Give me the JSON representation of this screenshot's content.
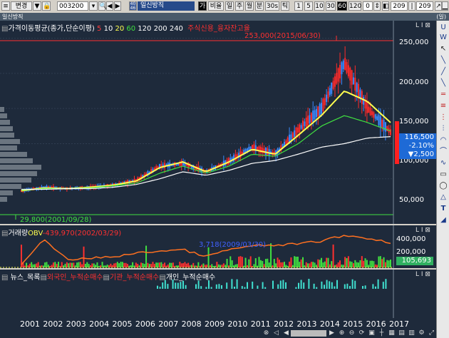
{
  "toolbar": {
    "code": "003200",
    "badge": "40\n46",
    "stock_name": "일신방직",
    "buttons": [
      "가",
      "비율",
      "일",
      "주",
      "월",
      "분",
      "30s",
      "틱"
    ],
    "periods": [
      "1",
      "5",
      "10",
      "30",
      "60",
      "120"
    ],
    "period_count": "0",
    "count_a": "209",
    "count_b": "209"
  },
  "titlebar": {
    "title": "일신방직",
    "right": "(일)"
  },
  "price_panel": {
    "header": "가격이동평균(종가,단순이평)",
    "ma_labels": [
      {
        "text": "5",
        "color": "#ff3c3c"
      },
      {
        "text": "10",
        "color": "#ffffff"
      },
      {
        "text": "20",
        "color": "#ffff50"
      },
      {
        "text": "60",
        "color": "#40e040"
      },
      {
        "text": "120",
        "color": "#ffffff"
      },
      {
        "text": "200",
        "color": "#ffffff"
      },
      {
        "text": "240",
        "color": "#ffffff"
      }
    ],
    "credit_label": "주식신용_융자잔고율",
    "high_label": "253,000(2015/06/30)",
    "low_label": "29,800(2001/09/28)",
    "y_ticks": [
      "250,000",
      "200,000",
      "150,000",
      "100,000",
      "50,000"
    ],
    "current_price": "116,500",
    "change_pct": "-2.10%",
    "change_amt": "▼2,500"
  },
  "volume_panel": {
    "header": "거래량",
    "obv_label": "OBV",
    "obv_value": "-439,970(2002/03/29)",
    "mark_label": "3,718(2009/03/30)",
    "y_ticks": [
      "400,000",
      "200,000"
    ],
    "current": "105,693"
  },
  "news_panel": {
    "labels": [
      {
        "text": "뉴스_목록",
        "color": "#ffffff"
      },
      {
        "text": "외국인_누적순매수",
        "color": "#ff3030"
      },
      {
        "text": "기관_누적순매수",
        "color": "#ff3030"
      },
      {
        "text": "개인_누적순매수",
        "color": "#ffffff"
      }
    ]
  },
  "x_axis": [
    "2001",
    "2002",
    "2003",
    "2004",
    "2005",
    "2006",
    "2007",
    "2008",
    "2009",
    "2010",
    "2011",
    "2012",
    "2013",
    "2014",
    "2015",
    "2016",
    "2017"
  ],
  "chart_data": {
    "type": "line",
    "x": [
      "2001",
      "2002",
      "2003",
      "2004",
      "2005",
      "2006",
      "2007",
      "2008",
      "2009",
      "2010",
      "2011",
      "2012",
      "2013",
      "2014",
      "2015",
      "2016",
      "2017"
    ],
    "series": [
      {
        "name": "5",
        "values": [
          33000,
          38000,
          36000,
          38000,
          41000,
          48000,
          68000,
          72000,
          60000,
          75000,
          95000,
          85000,
          120000,
          150000,
          215000,
          150000,
          116500
        ]
      },
      {
        "name": "20",
        "values": [
          33000,
          37000,
          36000,
          38000,
          41000,
          47000,
          66000,
          74000,
          60000,
          74000,
          92000,
          85000,
          112000,
          140000,
          175000,
          160000,
          130000
        ]
      },
      {
        "name": "60",
        "values": [
          34000,
          36000,
          36000,
          37000,
          40000,
          44000,
          58000,
          68000,
          58000,
          68000,
          85000,
          82000,
          100000,
          125000,
          140000,
          130000,
          118000
        ]
      },
      {
        "name": "120",
        "values": [
          35000,
          35000,
          36000,
          36000,
          38000,
          42000,
          50000,
          60000,
          55000,
          62000,
          72000,
          76000,
          85000,
          95000,
          100000,
          108000,
          110000
        ]
      }
    ],
    "ylim": [
      30000,
      260000
    ],
    "high": {
      "x": "2015/06/30",
      "y": 253000
    },
    "low": {
      "x": "2001/09/28",
      "y": 29800
    }
  }
}
